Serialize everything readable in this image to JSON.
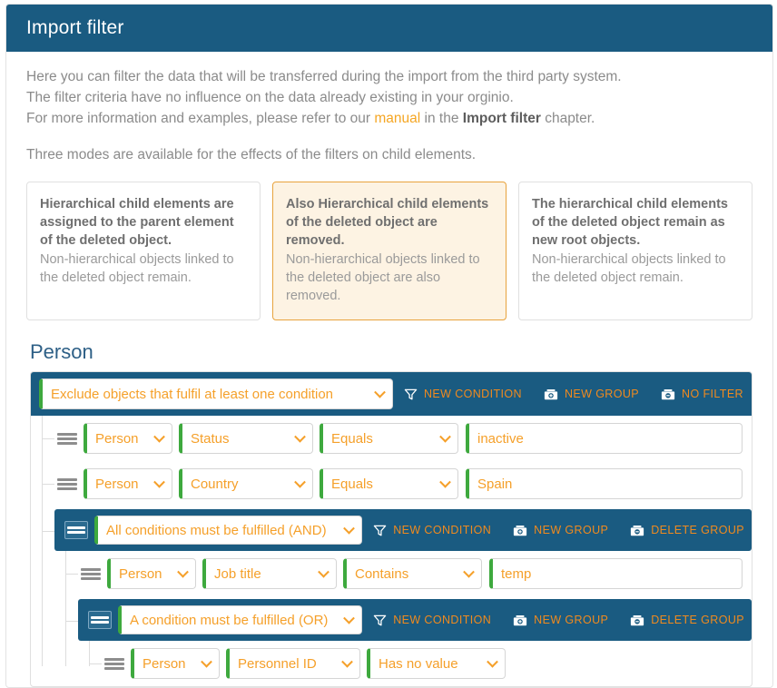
{
  "header": {
    "title": "Import filter"
  },
  "intro": {
    "line1": "Here you can filter the data that will be transferred during the import from the third party system.",
    "line2": "The filter criteria have no influence on the data already existing in your orginio.",
    "line3_pre": "For more information and examples, please refer to our ",
    "link": "manual",
    "line3_mid": " in the ",
    "strong": "Import filter",
    "line3_post": " chapter.",
    "line4": "Three modes are available for the effects of the filters on child elements."
  },
  "modes": [
    {
      "title": "Hierarchical child elements are assigned to the parent element of the deleted object.",
      "sub": "Non-hierarchical objects linked to the deleted object remain.",
      "selected": false
    },
    {
      "title": "Also Hierarchical child elements of the deleted object are removed.",
      "sub": "Non-hierarchical objects linked to the deleted object are also removed.",
      "selected": true
    },
    {
      "title": "The hierarchical child elements of the deleted object remain as new root objects.",
      "sub": "Non-hierarchical objects linked to the deleted object remain.",
      "selected": false
    }
  ],
  "section": {
    "title": "Person"
  },
  "root_group": {
    "mode": "Exclude objects that fulfil at least one condition",
    "actions": {
      "new_condition": "NEW CONDITION",
      "new_group": "NEW GROUP",
      "no_filter": "NO FILTER"
    }
  },
  "conditions": {
    "c1": {
      "object": "Person",
      "field": "Status",
      "operator": "Equals",
      "value": "inactive"
    },
    "c2": {
      "object": "Person",
      "field": "Country",
      "operator": "Equals",
      "value": "Spain"
    },
    "c3": {
      "object": "Person",
      "field": "Job title",
      "operator": "Contains",
      "value": "temp"
    },
    "c4": {
      "object": "Person",
      "field": "Personnel ID",
      "operator": "Has no value"
    }
  },
  "and_group": {
    "mode": "All conditions must be fulfilled (AND)",
    "actions": {
      "new_condition": "NEW CONDITION",
      "new_group": "NEW GROUP",
      "delete_group": "DELETE GROUP"
    }
  },
  "or_group": {
    "mode": "A condition must be fulfilled (OR)",
    "actions": {
      "new_condition": "NEW CONDITION",
      "new_group": "NEW GROUP",
      "delete_group": "DELETE GROUP"
    }
  },
  "colors": {
    "header_blue": "#1a5b81",
    "accent_orange": "#f5a02a",
    "valid_green": "#3ea93e",
    "selected_card_bg": "#fdf3e3",
    "selected_card_border": "#e8a33d"
  },
  "icons": {
    "filter": "funnel-icon",
    "group_add": "folder-plus-icon",
    "group_remove": "folder-minus-icon",
    "drag": "drag-handle-icon",
    "chevron": "chevron-down-icon"
  }
}
